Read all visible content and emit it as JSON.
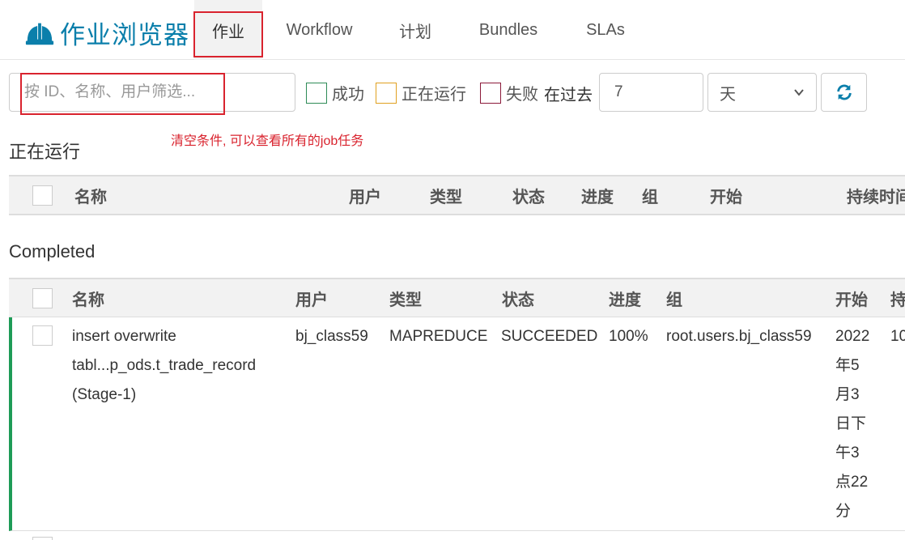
{
  "header": {
    "logo_text": "作业浏览器",
    "tabs": [
      {
        "label": "作业",
        "active": true
      },
      {
        "label": "Workflow"
      },
      {
        "label": "计划"
      },
      {
        "label": "Bundles"
      },
      {
        "label": "SLAs"
      }
    ]
  },
  "filters": {
    "search_placeholder": "按 ID、名称、用户筛选...",
    "hint": "清空条件, 可以查看所有的job任务",
    "succeeded_label": "成功",
    "running_label": "正在运行",
    "failed_label": "失败",
    "in_past_label": "在过去",
    "days_value": "7",
    "unit_selected": "天"
  },
  "running": {
    "title": "正在运行",
    "columns": [
      "名称",
      "用户",
      "类型",
      "状态",
      "进度",
      "组",
      "开始",
      "持续时间"
    ]
  },
  "completed": {
    "title": "Completed",
    "columns": [
      "名称",
      "用户",
      "类型",
      "状态",
      "进度",
      "组",
      "开始",
      "持"
    ],
    "rows": [
      {
        "name_lines": [
          "insert overwrite",
          "tabl...p_ods.t_trade_record",
          "(Stage-1)"
        ],
        "user": "bj_class59",
        "type": "MAPREDUCE",
        "status": "SUCCEEDED",
        "progress": "100%",
        "group": "root.users.bj_class59",
        "start_lines": [
          "2022",
          "年5",
          "月3",
          "日下",
          "午3",
          "点22",
          "分"
        ],
        "duration_partial": "10"
      }
    ]
  },
  "colors": {
    "accent": "#0b7fab",
    "success": "#1e9b57",
    "annotation_red": "#d9232e"
  }
}
